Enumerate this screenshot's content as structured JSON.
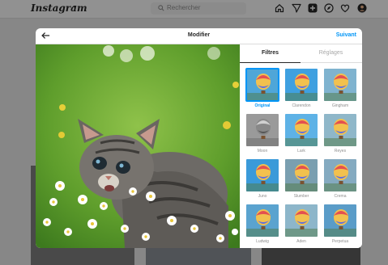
{
  "app": {
    "logo_text": "Instagram",
    "search_placeholder": "Rechercher"
  },
  "modal": {
    "title": "Modifier",
    "next_label": "Suivant",
    "tabs": [
      {
        "label": "Filtres",
        "active": true
      },
      {
        "label": "Réglages",
        "active": false
      }
    ],
    "filters": [
      {
        "label": "Original",
        "selected": true
      },
      {
        "label": "Clarendon",
        "selected": false
      },
      {
        "label": "Gingham",
        "selected": false
      },
      {
        "label": "Moon",
        "selected": false
      },
      {
        "label": "Lark",
        "selected": false
      },
      {
        "label": "Reyes",
        "selected": false
      },
      {
        "label": "Juno",
        "selected": false
      },
      {
        "label": "Slumber",
        "selected": false
      },
      {
        "label": "Crema",
        "selected": false
      },
      {
        "label": "Ludwig",
        "selected": false
      },
      {
        "label": "Aden",
        "selected": false
      },
      {
        "label": "Perpetua",
        "selected": false
      }
    ]
  },
  "colors": {
    "accent": "#0095f6",
    "text": "#262626",
    "muted": "#8e8e8e"
  }
}
